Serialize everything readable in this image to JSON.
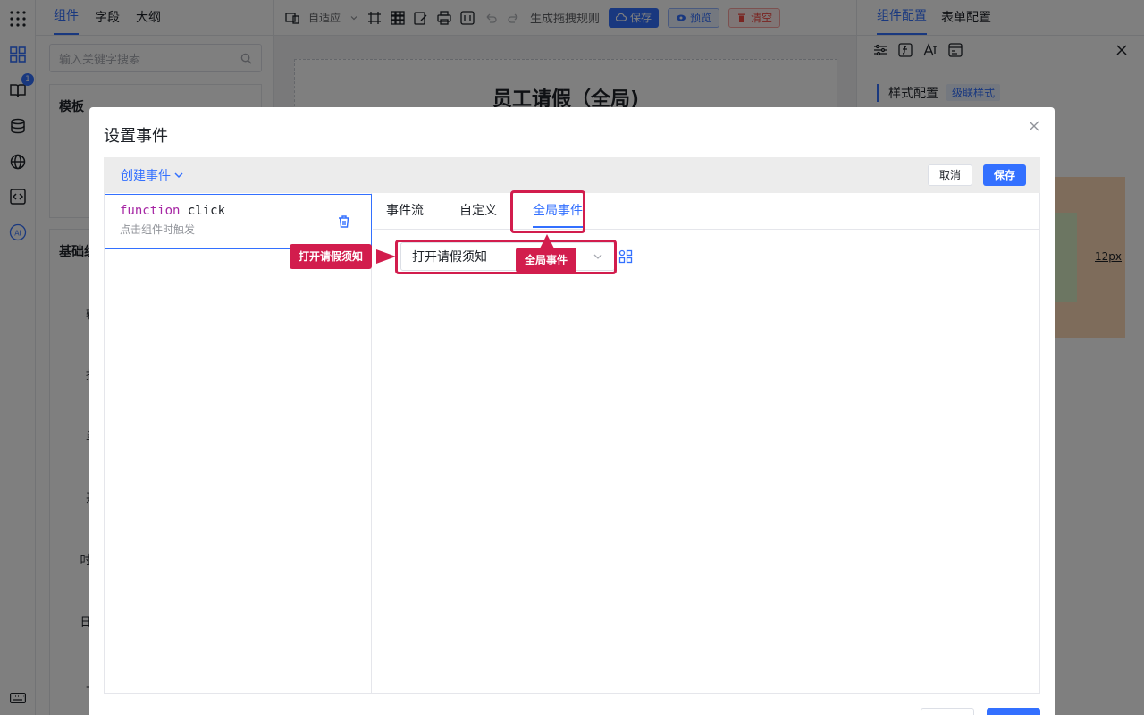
{
  "left_tabs": [
    "组件",
    "字段",
    "大纲"
  ],
  "search": {
    "placeholder": "输入关键字搜索"
  },
  "template_section": {
    "title": "模板"
  },
  "basic_section": {
    "title": "基础组",
    "components": [
      "输入",
      "提及",
      "单选",
      "开关",
      "时间区",
      "日期区",
      "上传"
    ]
  },
  "rail": {
    "badge": "1",
    "ai_label": "AI"
  },
  "toolbar": {
    "adapt": "自适应",
    "rule": "生成拖拽规则",
    "save": "保存",
    "preview": "预览",
    "clear": "清空"
  },
  "form": {
    "title": "员工请假（全局)"
  },
  "right_panel": {
    "tabs": [
      "组件配置",
      "表单配置"
    ],
    "style_config": "样式配置",
    "cascade": "级联样式",
    "px_value": "12px"
  },
  "modal": {
    "title": "设置事件",
    "create_event": "创建事件",
    "cancel": "取消",
    "save": "保存",
    "event_item": {
      "keyword": "function",
      "name": "click",
      "desc": "点击组件时触发"
    },
    "tabs": [
      "事件流",
      "自定义",
      "全局事件"
    ],
    "active_tab": "全局事件",
    "select_value": "打开请假须知"
  },
  "annotations": {
    "select_callout": "打开请假须知",
    "tab_callout": "全局事件"
  },
  "colors": {
    "accent": "#3370ff",
    "annotation": "#d21d4d",
    "danger": "#f54a45"
  }
}
